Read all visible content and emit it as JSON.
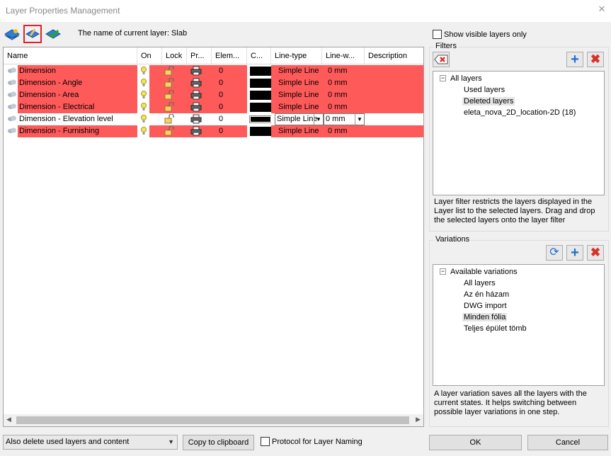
{
  "window": {
    "title": "Layer Properties Management"
  },
  "toolbar": {
    "current_layer_text": "The name of current layer: Slab"
  },
  "table": {
    "columns": [
      "Name",
      "On",
      "Lock",
      "Pr...",
      "Elem...",
      "C...",
      "Line-type",
      "Line-w...",
      "Description"
    ],
    "rows": [
      {
        "name": "Dimension",
        "elements": "0",
        "linetype": "Simple Line",
        "linewidth": "0 mm",
        "selected": false
      },
      {
        "name": "Dimension - Angle",
        "elements": "0",
        "linetype": "Simple Line",
        "linewidth": "0 mm",
        "selected": false
      },
      {
        "name": "Dimension - Area",
        "elements": "0",
        "linetype": "Simple Line",
        "linewidth": "0 mm",
        "selected": false
      },
      {
        "name": "Dimension - Electrical",
        "elements": "0",
        "linetype": "Simple Line",
        "linewidth": "0 mm",
        "selected": false
      },
      {
        "name": "Dimension - Elevation level",
        "elements": "0",
        "linetype": "Simple Line",
        "linewidth": "0 mm",
        "selected": true
      },
      {
        "name": "Dimension - Furnishing",
        "elements": "0",
        "linetype": "Simple Line",
        "linewidth": "0 mm",
        "selected": false
      }
    ]
  },
  "right": {
    "show_visible_label": "Show visible layers only",
    "filters": {
      "label": "Filters",
      "tree": [
        "All layers",
        "Used layers",
        "Deleted layers",
        "eleta_nova_2D_location-2D (18)"
      ],
      "description": "Layer filter restricts the layers displayed in the Layer list to the selected layers. Drag and drop the selected layers onto the layer filter"
    },
    "variations": {
      "label": "Variations",
      "tree": [
        "Available variations",
        "All layers",
        "Az én házam",
        "DWG import",
        "Minden fólia",
        "Teljes épület tömb"
      ],
      "description": "A layer variation saves all the layers with the current states. It helps switching between possible layer variations in one step."
    }
  },
  "bottom": {
    "delete_option": "Also delete used layers and content",
    "copy_label": "Copy to clipboard",
    "protocol_label": "Protocol for Layer Naming",
    "ok_label": "OK",
    "cancel_label": "Cancel"
  },
  "colors": {
    "highlight_row": "#ff5a5a",
    "accent_blue": "#1f6fd0",
    "delete_red": "#d9302a"
  }
}
